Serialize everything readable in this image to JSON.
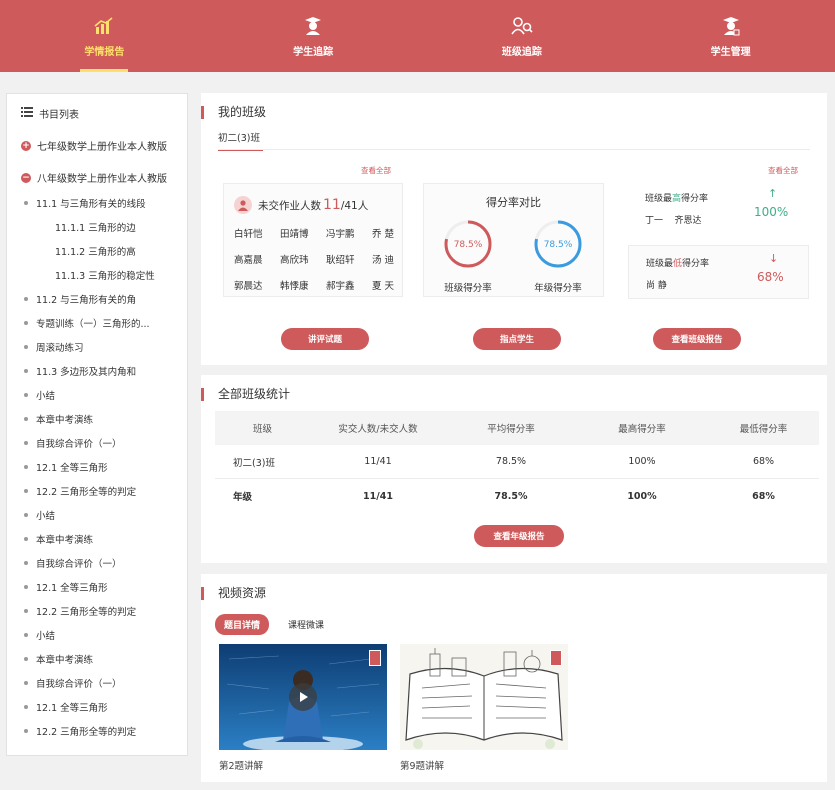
{
  "nav": {
    "items": [
      {
        "label": "学情报告",
        "icon": "chart-icon",
        "active": true
      },
      {
        "label": "学生追踪",
        "icon": "student-icon",
        "active": false
      },
      {
        "label": "班级追踪",
        "icon": "class-track-icon",
        "active": false
      },
      {
        "label": "学生管理",
        "icon": "student-manage-icon",
        "active": false
      }
    ],
    "active_color": "#ffe06b",
    "bg_color": "#cf5a5b"
  },
  "sidebar": {
    "title": "书目列表",
    "books": [
      {
        "label": "七年级数学上册作业本人教版",
        "expanded": false
      },
      {
        "label": "八年级数学上册作业本人教版",
        "expanded": true
      }
    ],
    "items": [
      {
        "label": "11.1 与三角形有关的线段",
        "level": 1
      },
      {
        "label": "11.1.1 三角形的边",
        "level": 2
      },
      {
        "label": "11.1.2 三角形的高",
        "level": 2
      },
      {
        "label": "11.1.3 三角形的稳定性",
        "level": 2
      },
      {
        "label": "11.2 与三角形有关的角",
        "level": 1
      },
      {
        "label": "专题训练（一）三角形的...",
        "level": 1
      },
      {
        "label": "周滚动练习",
        "level": 1
      },
      {
        "label": "11.3 多边形及其内角和",
        "level": 1
      },
      {
        "label": "小结",
        "level": 1
      },
      {
        "label": "本章中考演练",
        "level": 1
      },
      {
        "label": "自我综合评价（一）",
        "level": 1
      },
      {
        "label": "12.1 全等三角形",
        "level": 1
      },
      {
        "label": "12.2 三角形全等的判定",
        "level": 1
      },
      {
        "label": "小结",
        "level": 1
      },
      {
        "label": "本章中考演练",
        "level": 1
      },
      {
        "label": "自我综合评价（一）",
        "level": 1
      },
      {
        "label": "12.1 全等三角形",
        "level": 1
      },
      {
        "label": "12.2 三角形全等的判定",
        "level": 1
      },
      {
        "label": "小结",
        "level": 1
      },
      {
        "label": "本章中考演练",
        "level": 1
      },
      {
        "label": "自我综合评价（一）",
        "level": 1
      },
      {
        "label": "12.1 全等三角形",
        "level": 1
      },
      {
        "label": "12.2 三角形全等的判定",
        "level": 1
      }
    ]
  },
  "my_class": {
    "title": "我的班级",
    "tab": "初二(3)班",
    "view_all_1": "查看全部",
    "view_all_2": "查看全部",
    "missing": {
      "label": "未交作业人数",
      "count": "11",
      "total": "/41人",
      "names": [
        "白轩恺",
        "田靖博",
        "冯宇鹏",
        "乔 楚",
        "高嘉晨",
        "高欣玮",
        "耿绍轩",
        "汤 迪",
        "郭晨达",
        "韩悸康",
        "郝宇鑫",
        "夏 天"
      ]
    },
    "compare": {
      "title": "得分率对比",
      "class_rate": 78.5,
      "class_rate_text": "78.5%",
      "class_label": "班级得分率",
      "grade_rate": 78.5,
      "grade_rate_text": "78.5%",
      "grade_label": "年级得分率",
      "class_color": "#cf5a5b",
      "grade_color": "#3a9be0"
    },
    "highest": {
      "label_a": "班级最",
      "label_hl": "高",
      "label_b": "得分率",
      "names": "丁一    齐恩达",
      "arrow": "↑",
      "value": "100%",
      "color": "#3fae8a"
    },
    "lowest": {
      "label_a": "班级最",
      "label_hl": "低",
      "label_b": "得分率",
      "names": "尚 静",
      "arrow": "↓",
      "value": "68%",
      "color": "#cf5a5b"
    },
    "buttons": {
      "review": "讲评试题",
      "guide": "指点学生",
      "report": "查看班级报告"
    }
  },
  "all_stats": {
    "title": "全部班级统计",
    "headers": [
      "班级",
      "实交人数/未交人数",
      "平均得分率",
      "最高得分率",
      "最低得分率"
    ],
    "rows": [
      [
        "初二(3)班",
        "11/41",
        "78.5%",
        "100%",
        "68%"
      ],
      [
        "年级",
        "11/41",
        "78.5%",
        "100%",
        "68%"
      ]
    ],
    "button": "查看年级报告"
  },
  "video": {
    "title": "视频资源",
    "tabs": [
      {
        "label": "题目详情",
        "active": true
      },
      {
        "label": "课程微课",
        "active": false
      }
    ],
    "items": [
      {
        "caption": "第2题讲解"
      },
      {
        "caption": "第9题讲解"
      }
    ]
  }
}
